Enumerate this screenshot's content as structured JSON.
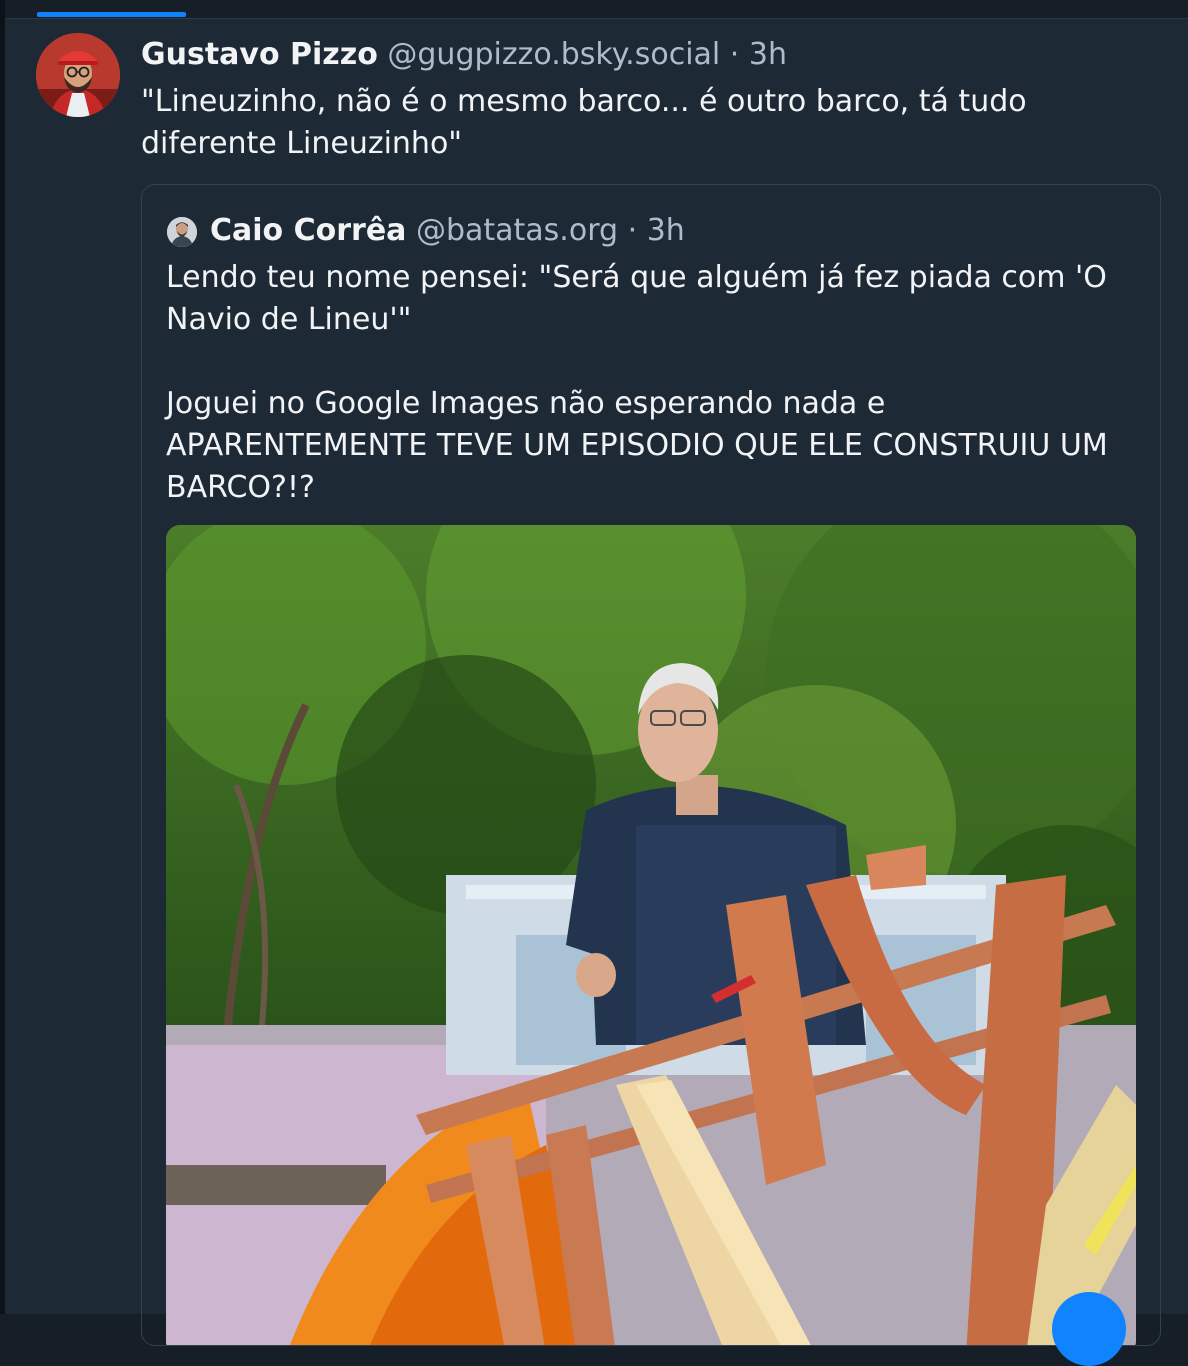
{
  "post": {
    "display_name": "Gustavo Pizzo",
    "handle": "@gugpizzo.bsky.social",
    "separator": "·",
    "time": "3h",
    "text": "\"Lineuzinho, não é o mesmo barco... é outro barco, tá tudo diferente Lineuzinho\""
  },
  "quote": {
    "display_name": "Caio Corrêa",
    "handle": "@batatas.org",
    "separator": "·",
    "time": "3h",
    "text": "Lendo teu nome pensei: \"Será que alguém já fez piada com 'O Navio de Lineu'\"\n\nJoguei no Google Images não esperando nada e APARENTEMENTE TEVE UM EPISODIO QUE ELE CONSTRUIU UM BARCO?!?"
  },
  "colors": {
    "background": "#1e2936",
    "accent": "#1083fe",
    "text_primary": "#f1f3f5",
    "text_secondary": "#aebbc9",
    "border": "#334253"
  },
  "icons": {
    "post_avatar": "avatar-red-cap",
    "quote_avatar": "avatar-small"
  }
}
